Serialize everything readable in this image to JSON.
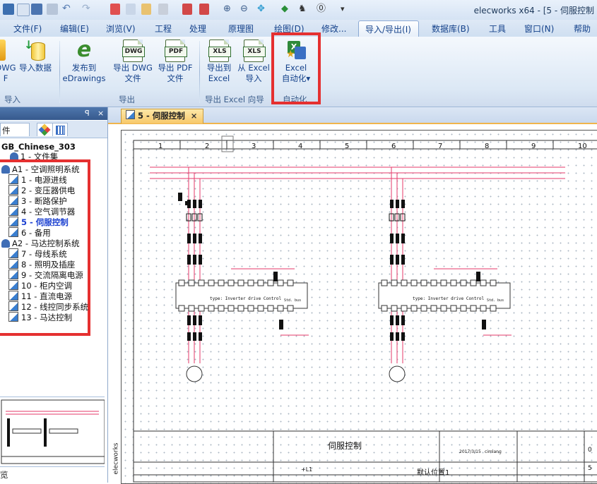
{
  "titlebar": {
    "title": "elecworks x64 - [5 - 伺服控制"
  },
  "menu": {
    "items": [
      "文件(F)",
      "编辑(E)",
      "浏览(V)",
      "工程",
      "处理",
      "原理图",
      "绘图(D)",
      "修改...",
      "导入/导出(I)",
      "数据库(B)",
      "工具",
      "窗口(N)",
      "帮助"
    ],
    "active": "导入/导出(I)"
  },
  "ribbon": {
    "groups": [
      "导入",
      "导出",
      "导出 Excel 向导",
      "自动化"
    ],
    "buttons": [
      {
        "line1": "DWG",
        "line2": "F"
      },
      {
        "line1": "导入数据",
        "line2": ""
      },
      {
        "line1": "发布到",
        "line2": "eDrawings"
      },
      {
        "line1": "导出 DWG",
        "line2": "文件",
        "tag": "DWG"
      },
      {
        "line1": "导出 PDF",
        "line2": "文件",
        "tag": "PDF"
      },
      {
        "line1": "导出到",
        "line2": "Excel",
        "tag": "XLS"
      },
      {
        "line1": "从 Excel",
        "line2": "导入",
        "tag": "XLS"
      },
      {
        "line1": "Excel",
        "line2": "自动化▾"
      }
    ]
  },
  "leftpanel": {
    "pin": "ꟼ",
    "close": "×",
    "tab_label": "件",
    "project": "GB_Chinese_303",
    "doc_set": "1 - 文件集",
    "tree": [
      {
        "label": "A1 - 空调照明系统",
        "kind": "folder"
      },
      {
        "label": "1 - 电源进线",
        "kind": "page"
      },
      {
        "label": "2 - 变压器供电",
        "kind": "page"
      },
      {
        "label": "3 - 断路保护",
        "kind": "page"
      },
      {
        "label": "4 - 空气调节器",
        "kind": "page"
      },
      {
        "label": "5 - 伺服控制",
        "kind": "page",
        "selected": true
      },
      {
        "label": "6 - 备用",
        "kind": "page"
      },
      {
        "label": "A2 - 马达控制系统",
        "kind": "folder"
      },
      {
        "label": "7 - 母线系统",
        "kind": "page"
      },
      {
        "label": "8 - 照明及插座",
        "kind": "page"
      },
      {
        "label": "9 - 交流隔离电源",
        "kind": "page"
      },
      {
        "label": "10 - 柜内空调",
        "kind": "page"
      },
      {
        "label": "11 - 直流电源",
        "kind": "page"
      },
      {
        "label": "12 - 线控同步系统",
        "kind": "page"
      },
      {
        "label": "13 - 马达控制",
        "kind": "page"
      }
    ],
    "preview_label": "览"
  },
  "document": {
    "tab": "5 - 伺服控制",
    "close": "×",
    "ruler": [
      "1",
      "2",
      "3",
      "4",
      "5",
      "6",
      "7",
      "8",
      "9",
      "10"
    ],
    "drive_type": "type: Inverter drive Control",
    "drive_ref": "Std. bus",
    "title_block": {
      "title": "伺服控制",
      "date": "2017/3/15",
      "user": "cimlang",
      "location": "默认位置1",
      "sheet_no": "5",
      "rev": "0",
      "logo": "elecworks",
      "bus": "+L1"
    }
  },
  "colors": {
    "highlight": "#e53030",
    "busbar": "#e53a6a"
  }
}
